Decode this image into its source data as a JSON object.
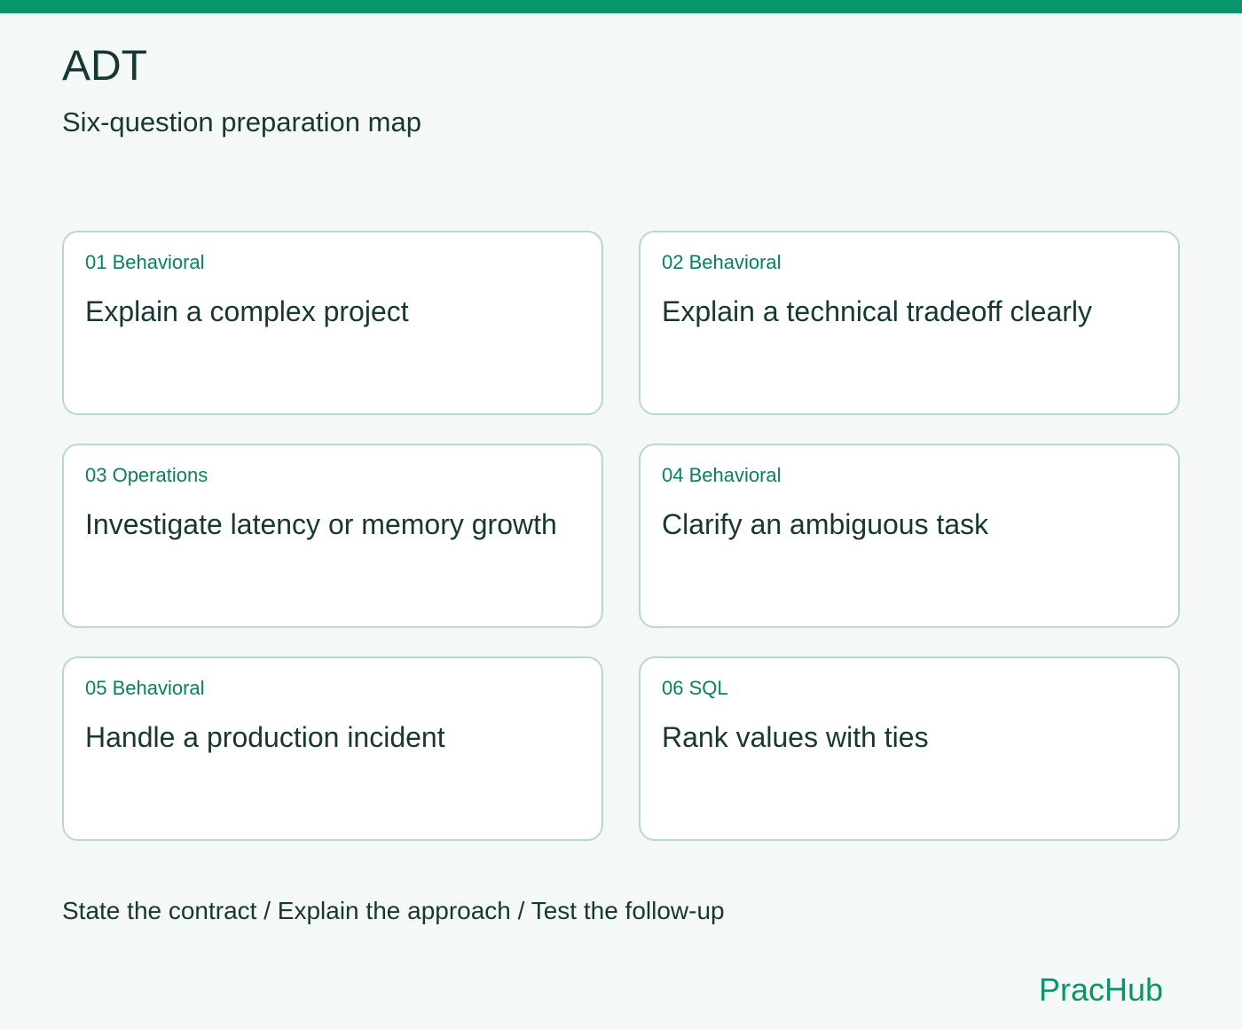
{
  "header": {
    "title": "ADT",
    "subtitle": "Six-question preparation map"
  },
  "cards": [
    {
      "category": "01 Behavioral",
      "title": "Explain a complex project"
    },
    {
      "category": "02 Behavioral",
      "title": "Explain a technical tradeoff clearly"
    },
    {
      "category": "03 Operations",
      "title": "Investigate latency or memory growth"
    },
    {
      "category": "04 Behavioral",
      "title": "Clarify an ambiguous task"
    },
    {
      "category": "05 Behavioral",
      "title": "Handle a production incident"
    },
    {
      "category": "06 SQL",
      "title": "Rank values with ties"
    }
  ],
  "footer": {
    "approach": "State the contract / Explain the approach / Test the follow-up",
    "brand": "PracHub"
  },
  "colors": {
    "accent": "#06966c",
    "category_text": "#0a7f5f",
    "primary_text": "#173732",
    "card_border": "#b8d8cf",
    "background": "#f4f8f6",
    "card_background": "#ffffff"
  }
}
